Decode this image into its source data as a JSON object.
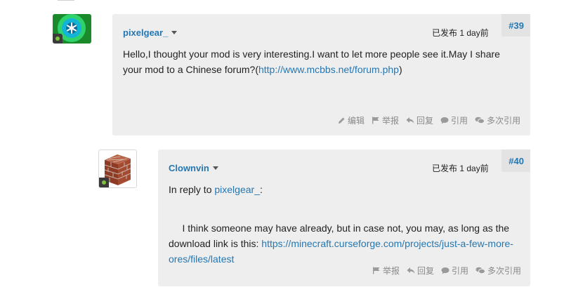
{
  "posts": [
    {
      "author": "pixelgear_",
      "post_number": "#39",
      "timestamp": "已发布 1 day前",
      "body_text": "Hello,I thought your mod is very interesting.I want to let more people see it.May I share your mod to a Chinese forum?(",
      "body_link": "http://www.mcbbs.net/forum.php",
      "body_tail": ")",
      "actions": {
        "edit": "编辑",
        "report": "举报",
        "reply": "回复",
        "quote": "引用",
        "multiquote": "多次引用"
      }
    },
    {
      "author": "Clownvin",
      "post_number": "#40",
      "timestamp": "已发布 1 day前",
      "reply_prefix": "In reply to ",
      "reply_to": "pixelgear_",
      "reply_suffix": ":",
      "body_text": " I think someone may have already, but in case not, you may, as long as the download link is this: ",
      "body_link": "https://minecraft.curseforge.com/projects/just-a-few-more-ores/files/latest",
      "actions": {
        "report": "举报",
        "reply": "回复",
        "quote": "引用",
        "multiquote": "多次引用"
      }
    }
  ],
  "colors": {
    "link": "#2577b1",
    "post_background": "#eeeeee",
    "action_text": "#8a8a8a",
    "online_indicator": "#7cc23a"
  }
}
